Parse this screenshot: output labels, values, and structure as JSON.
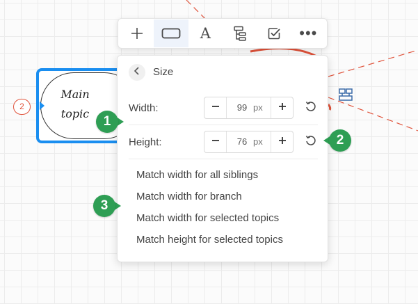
{
  "canvas": {
    "topic": {
      "text": "Main\ntopic"
    },
    "collapse_badge": "2"
  },
  "toolbar": {
    "items": [
      {
        "icon": "plus-icon"
      },
      {
        "icon": "shape-icon",
        "active": true
      },
      {
        "icon": "text-style-icon",
        "glyph": "A"
      },
      {
        "icon": "structure-icon"
      },
      {
        "icon": "task-checkbox-icon"
      },
      {
        "icon": "more-icon",
        "glyph": "•••"
      }
    ]
  },
  "size_panel": {
    "title": "Size",
    "width": {
      "label": "Width:",
      "value": "99",
      "unit": "px",
      "minus": "−",
      "plus": "+"
    },
    "height": {
      "label": "Height:",
      "value": "76",
      "unit": "px",
      "minus": "−",
      "plus": "+"
    },
    "menu": [
      "Match width for all siblings",
      "Match width for branch",
      "Match width for selected topics",
      "Match height for selected topics"
    ]
  },
  "annotations": [
    "1",
    "2",
    "3"
  ],
  "colors": {
    "selection": "#1a8ef0",
    "relation_line": "#e0533b",
    "marker": "#2e9e54",
    "toolbar_active": "#eef3fb"
  }
}
